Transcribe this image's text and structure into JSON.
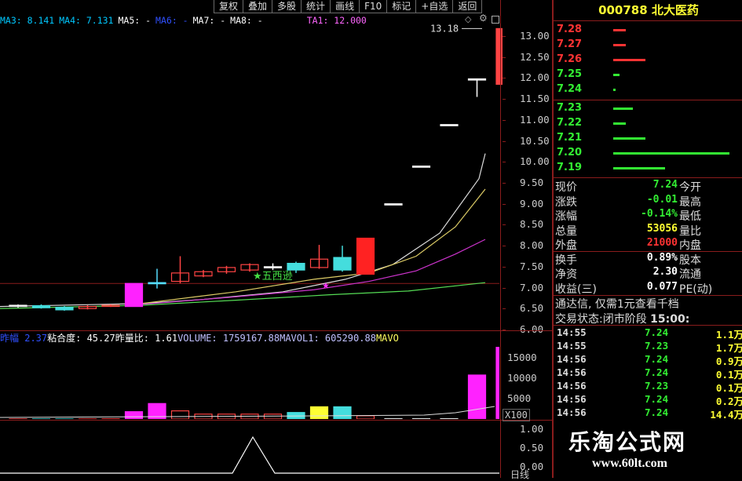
{
  "toolbar": [
    "复权",
    "叠加",
    "多股",
    "统计",
    "画线",
    "F10",
    "标记",
    "+自选",
    "返回"
  ],
  "ma_legend": [
    {
      "text": "MA3: 8.141",
      "color": "#00c8ff"
    },
    {
      "text": "MA4: 7.131",
      "color": "#00c8ff"
    },
    {
      "text": "MA5: -",
      "color": "#ffffff"
    },
    {
      "text": "MA6: -",
      "color": "#3050ff"
    },
    {
      "text": "MA7: -",
      "color": "#ffffff"
    },
    {
      "text": "MA8: -",
      "color": "#ffffff"
    },
    {
      "text": "TA1: 12.000",
      "color": "#ff66ff"
    }
  ],
  "price_axis": [
    "13.00",
    "12.50",
    "12.00",
    "11.50",
    "11.00",
    "10.50",
    "10.00",
    "9.50",
    "9.00",
    "8.50",
    "8.00",
    "7.50",
    "7.00",
    "6.50",
    "6.00"
  ],
  "annotations": {
    "high_label": "13.18",
    "signal_text": "五西逊",
    "signal_star": "★"
  },
  "volume_legend": {
    "prefix": "昨幅 2.37",
    "items": [
      {
        "text": "粘合度: 45.27",
        "color": "#ffffff"
      },
      {
        "text": "昨量比: 1.61",
        "color": "#ffffff"
      },
      {
        "text": "VOLUME: 1759167.88",
        "color": "#c0c0ff"
      },
      {
        "text": "MAVOL1: 605290.88",
        "color": "#c0c0ff"
      },
      {
        "text": "MAVO",
        "color": "#ffff60"
      }
    ]
  },
  "volume_axis": [
    "15000",
    "10000",
    "5000"
  ],
  "volume_unit": "X100",
  "indicator_axis": [
    "1.00",
    "0.50",
    "0.00"
  ],
  "bottom_label": "日线",
  "stock": {
    "code": "000788",
    "name": "北大医药"
  },
  "orderbook": {
    "sell": [
      {
        "price": "7.28",
        "vol": 2
      },
      {
        "price": "7.27",
        "vol": 2
      },
      {
        "price": "7.26",
        "vol": 5
      },
      {
        "price": "7.25",
        "vol": 1
      },
      {
        "price": "7.24",
        "vol": 0.3
      }
    ],
    "buy": [
      {
        "price": "7.23",
        "vol": 3
      },
      {
        "price": "7.22",
        "vol": 2
      },
      {
        "price": "7.21",
        "vol": 5
      },
      {
        "price": "7.20",
        "vol": 18
      },
      {
        "price": "7.19",
        "vol": 8
      }
    ]
  },
  "quote": [
    {
      "l": "现价",
      "v": "7.24",
      "vc": "#33ee33",
      "r": "今开"
    },
    {
      "l": "涨跌",
      "v": "-0.01",
      "vc": "#33ee33",
      "r": "最高"
    },
    {
      "l": "涨幅",
      "v": "-0.14%",
      "vc": "#33ee33",
      "r": "最低"
    },
    {
      "l": "总量",
      "v": "53056",
      "vc": "#ffff33",
      "r": "量比"
    },
    {
      "l": "外盘",
      "v": "21000",
      "vc": "#ff3333",
      "r": "内盘"
    },
    {
      "l": "换手",
      "v": "0.89%",
      "vc": "#ffffff",
      "r": "股本"
    },
    {
      "l": "净资",
      "v": "2.30",
      "vc": "#ffffff",
      "r": "流通"
    },
    {
      "l": "收益(三)",
      "v": "0.077",
      "vc": "#ffffff",
      "r": "PE(动)"
    }
  ],
  "promo": "通达信, 仅需1元查看千档",
  "status": {
    "label": "交易状态:",
    "value": "闭市阶段",
    "time": "15:00:"
  },
  "ticks": [
    {
      "t": "14:55",
      "p": "7.24",
      "v": "1.1万"
    },
    {
      "t": "14:55",
      "p": "7.23",
      "v": "1.7万"
    },
    {
      "t": "14:56",
      "p": "7.24",
      "v": "0.9万"
    },
    {
      "t": "14:56",
      "p": "7.24",
      "v": "0.1万"
    },
    {
      "t": "14:56",
      "p": "7.23",
      "v": "0.1万"
    },
    {
      "t": "14:56",
      "p": "7.24",
      "v": "0.2万"
    },
    {
      "t": "14:56",
      "p": "7.24",
      "v": "14.4万"
    }
  ],
  "watermark": {
    "title": "乐淘公式网",
    "url": "www.60lt.com"
  },
  "chart_data": {
    "type": "candlestick",
    "ylim": [
      6.0,
      13.3
    ],
    "candles": [
      {
        "o": 6.55,
        "c": 6.58,
        "h": 6.6,
        "l": 6.52,
        "color": "#eeeeee"
      },
      {
        "o": 6.57,
        "c": 6.52,
        "h": 6.6,
        "l": 6.5,
        "color": "#44dddd"
      },
      {
        "o": 6.53,
        "c": 6.47,
        "h": 6.56,
        "l": 6.45,
        "color": "#44dddd"
      },
      {
        "o": 6.5,
        "c": 6.55,
        "h": 6.58,
        "l": 6.48,
        "color": "#ff4444"
      },
      {
        "o": 6.56,
        "c": 6.58,
        "h": 6.6,
        "l": 6.54,
        "color": "#ff4444"
      },
      {
        "o": 6.55,
        "c": 7.1,
        "h": 7.1,
        "l": 6.55,
        "color": "#ff22ff"
      },
      {
        "o": 7.12,
        "c": 7.12,
        "h": 7.45,
        "l": 6.98,
        "color": "#55ddff"
      },
      {
        "o": 7.15,
        "c": 7.35,
        "h": 7.75,
        "l": 7.1,
        "color": "#ff4444"
      },
      {
        "o": 7.28,
        "c": 7.38,
        "h": 7.42,
        "l": 7.25,
        "color": "#ff4444"
      },
      {
        "o": 7.38,
        "c": 7.48,
        "h": 7.52,
        "l": 7.33,
        "color": "#ff4444"
      },
      {
        "o": 7.42,
        "c": 7.55,
        "h": 7.58,
        "l": 7.38,
        "color": "#ff4444"
      },
      {
        "o": 7.5,
        "c": 7.5,
        "h": 7.58,
        "l": 7.42,
        "color": "#ffffff"
      },
      {
        "o": 7.58,
        "c": 7.42,
        "h": 7.62,
        "l": 7.35,
        "color": "#44dddd"
      },
      {
        "o": 7.48,
        "c": 7.68,
        "h": 8.02,
        "l": 7.45,
        "color": "#ff4444"
      },
      {
        "o": 7.72,
        "c": 7.42,
        "h": 8.0,
        "l": 7.38,
        "color": "#44dddd"
      },
      {
        "o": 7.32,
        "c": 8.18,
        "h": 8.18,
        "l": 7.32,
        "color": "#ff2222"
      },
      {
        "o": 9.0,
        "c": 9.0,
        "h": 9.0,
        "l": 9.0,
        "color": "#ffffff"
      },
      {
        "o": 9.9,
        "c": 9.9,
        "h": 9.9,
        "l": 9.9,
        "color": "#ffffff"
      },
      {
        "o": 10.89,
        "c": 10.89,
        "h": 10.89,
        "l": 10.89,
        "color": "#ffffff"
      },
      {
        "o": 11.98,
        "c": 11.98,
        "h": 11.98,
        "l": 11.55,
        "color": "#ffffff"
      },
      {
        "o": 11.85,
        "c": 13.18,
        "h": 13.18,
        "l": 10.95,
        "color": "#ff4444"
      }
    ],
    "volumes": [
      30,
      20,
      25,
      40,
      60,
      1800,
      3800,
      2000,
      1200,
      1200,
      1200,
      1200,
      1600,
      3000,
      3000,
      800,
      60,
      60,
      60,
      10800,
      17600
    ],
    "volume_ylim": [
      0,
      18500
    ],
    "volume_colors": [
      "#ff4444",
      "#44dddd",
      "#44dddd",
      "#ff4444",
      "#ff4444",
      "#ff22ff",
      "#ff22ff",
      "#ff4444",
      "#ff4444",
      "#ff4444",
      "#ff4444",
      "#ff4444",
      "#44dddd",
      "#ffff33",
      "#44dddd",
      "#ff4444",
      "#ffffff",
      "#ffffff",
      "#ffffff",
      "#ff22ff",
      "#ff22ff"
    ],
    "indicator": [
      0,
      0,
      0,
      0,
      0,
      0,
      0,
      0,
      0,
      0,
      0,
      0,
      0,
      0,
      0,
      0,
      0,
      0,
      0,
      0,
      0,
      0,
      1,
      0,
      0,
      0,
      0,
      0,
      0,
      0,
      0,
      0,
      0,
      0,
      0,
      0,
      0,
      0,
      0,
      0,
      0,
      0
    ]
  }
}
